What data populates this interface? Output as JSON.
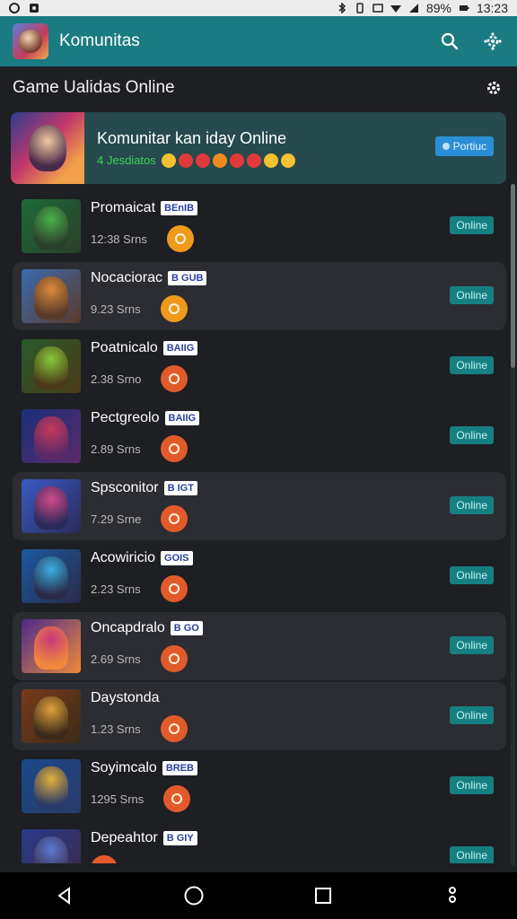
{
  "status_bar": {
    "battery": "89%",
    "time": "13:23"
  },
  "app_bar": {
    "title": "Komunitas"
  },
  "section": {
    "title": "Game Ualidas Online"
  },
  "banner": {
    "title": "Komunitar kan iday Online",
    "count": "4 Jesdiatos",
    "badge": "Portiuc",
    "emoji_colors": [
      "#f2c230",
      "#e03a3a",
      "#e03a3a",
      "#f08a1c",
      "#e03a3a",
      "#e03a3a",
      "#f2c230",
      "#f2c230"
    ]
  },
  "items": [
    {
      "name": "Promaicat",
      "tag": "BEnIB",
      "sub": "12:38 Srns",
      "status": "Online",
      "circle": "orange",
      "colors": [
        "#1d6b3a",
        "#4ab04a",
        "#2a3f2a"
      ],
      "alt": false
    },
    {
      "name": "Nocaciorac",
      "tag": "B GUB",
      "sub": "9.23 Srns",
      "status": "Online",
      "circle": "orange",
      "colors": [
        "#3a6bb0",
        "#d98a3a",
        "#5a3a2a"
      ],
      "alt": true
    },
    {
      "name": "Poatnicalo",
      "tag": "BAIIG",
      "sub": "2.38 Srno",
      "status": "Online",
      "circle": "red",
      "colors": [
        "#2a5a2a",
        "#8ac83a",
        "#4a3a1a"
      ],
      "alt": false
    },
    {
      "name": "Pectgreolo",
      "tag": "BAIIG",
      "sub": "2.89 Srns",
      "status": "Online",
      "circle": "red",
      "colors": [
        "#1a2f7a",
        "#c23a5a",
        "#5a2a6a"
      ],
      "alt": false
    },
    {
      "name": "Spsconitor",
      "tag": "B IGT",
      "sub": "7.29 Srne",
      "status": "Online",
      "circle": "red",
      "colors": [
        "#3a5ac2",
        "#d24a8a",
        "#2a2a5a"
      ],
      "alt": true
    },
    {
      "name": "Acowiricio",
      "tag": "GOIS",
      "sub": "2.23 Srns",
      "status": "Online",
      "circle": "red",
      "colors": [
        "#1a5aa0",
        "#3ab0e0",
        "#2a2a4a"
      ],
      "alt": false
    },
    {
      "name": "Oncapdralo",
      "tag": "B GO",
      "sub": "2.69 Srns",
      "status": "Online",
      "circle": "red",
      "colors": [
        "#4a2a8a",
        "#c83a7a",
        "#f08a3a"
      ],
      "alt": true
    },
    {
      "name": "Daystonda",
      "tag": "",
      "sub": "1.23 Srns",
      "status": "Online",
      "circle": "red",
      "colors": [
        "#7a3a1a",
        "#e0a03a",
        "#3a2a1a"
      ],
      "alt": true
    },
    {
      "name": "Soyimcalo",
      "tag": "BREB",
      "sub": "1295 Srns",
      "status": "Online",
      "circle": "red",
      "colors": [
        "#1a4a8a",
        "#e0b03a",
        "#2a3a6a"
      ],
      "alt": false
    },
    {
      "name": "Depeahtor",
      "tag": "B GIY",
      "sub": "",
      "status": "Online",
      "circle": "red",
      "colors": [
        "#2a3a8a",
        "#5a7ad0",
        "#3a2a4a"
      ],
      "alt": false
    }
  ]
}
